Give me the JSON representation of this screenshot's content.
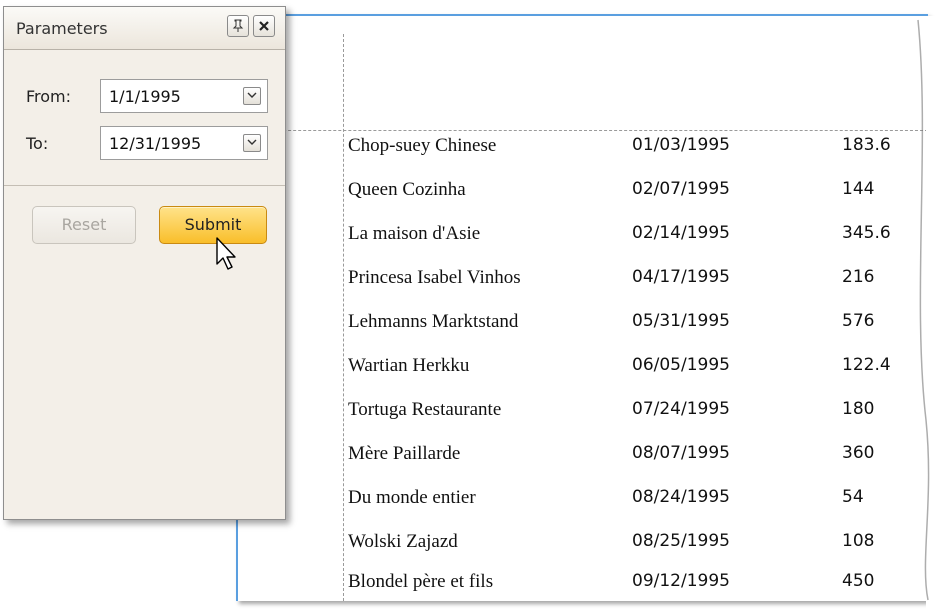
{
  "parameters_panel": {
    "title": "Parameters",
    "pin_icon": "pin-icon",
    "close_icon": "close-icon",
    "from_label": "From:",
    "from_value": "1/1/1995",
    "to_label": "To:",
    "to_value": "12/31/1995",
    "reset_label": "Reset",
    "submit_label": "Submit"
  },
  "report": {
    "rows": [
      {
        "name": "Chop-suey Chinese",
        "date": "01/03/1995",
        "amount": "183.6"
      },
      {
        "name": "Queen Cozinha",
        "date": "02/07/1995",
        "amount": "144"
      },
      {
        "name": "La maison d'Asie",
        "date": "02/14/1995",
        "amount": "345.6"
      },
      {
        "name": "Princesa Isabel Vinhos",
        "date": "04/17/1995",
        "amount": "216"
      },
      {
        "name": "Lehmanns Marktstand",
        "date": "05/31/1995",
        "amount": "576"
      },
      {
        "name": "Wartian Herkku",
        "date": "06/05/1995",
        "amount": "122.4"
      },
      {
        "name": "Tortuga Restaurante",
        "date": "07/24/1995",
        "amount": "180"
      },
      {
        "name": "Mère Paillarde",
        "date": "08/07/1995",
        "amount": "360"
      },
      {
        "name": "Du monde entier",
        "date": "08/24/1995",
        "amount": "54"
      },
      {
        "name": "Wolski  Zajazd",
        "date": "08/25/1995",
        "amount": "108"
      },
      {
        "name": "Blondel père et fils",
        "date": "09/12/1995",
        "amount": "450"
      }
    ]
  },
  "colors": {
    "page_border": "#5a9fe0",
    "submit_button": "#f9be2a",
    "panel_background": "#f3efe8"
  }
}
